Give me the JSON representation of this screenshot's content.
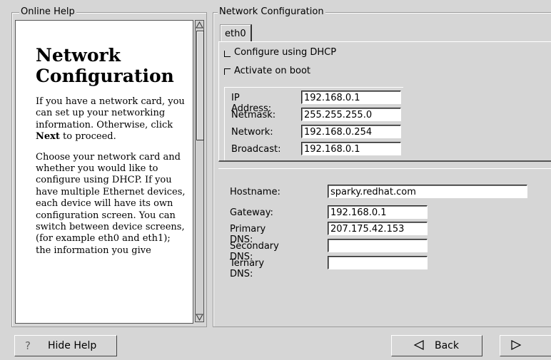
{
  "help": {
    "frame_title": "Online Help",
    "heading": "Network Configuration",
    "p1_a": "If you have a network card, you can set up your networking information. Otherwise, click ",
    "p1_bold": "Next",
    "p1_b": " to proceed.",
    "p2": "Choose your network card and whether you would like to configure using DHCP. If you have multiple Ethernet devices, each device will have its own configuration screen. You can switch between device screens, (for example eth0 and eth1); the information you give"
  },
  "network": {
    "frame_title": "Network Configuration",
    "tab": "eth0",
    "dhcp_label": "Configure using DHCP",
    "dhcp_checked": false,
    "boot_label": "Activate on boot",
    "boot_checked": false,
    "ip_label": "IP Address:",
    "ip_value": "192.168.0.1",
    "netmask_label": "Netmask:",
    "netmask_value": "255.255.255.0",
    "network_label": "Network:",
    "network_value": "192.168.0.254",
    "broadcast_label": "Broadcast:",
    "broadcast_value": "192.168.0.1"
  },
  "hosts": {
    "hostname_label": "Hostname:",
    "hostname_value": "sparky.redhat.com",
    "gateway_label": "Gateway:",
    "gateway_value": "192.168.0.1",
    "dns1_label": "Primary DNS:",
    "dns1_value": "207.175.42.153",
    "dns2_label": "Secondary DNS:",
    "dns2_value": "",
    "dns3_label": "Ternary DNS:",
    "dns3_value": ""
  },
  "buttons": {
    "hide_help": "Hide Help",
    "hide_help_icon": "help-icon",
    "back": "Back",
    "back_icon": "left-triangle-icon",
    "next_icon": "right-triangle-icon"
  }
}
